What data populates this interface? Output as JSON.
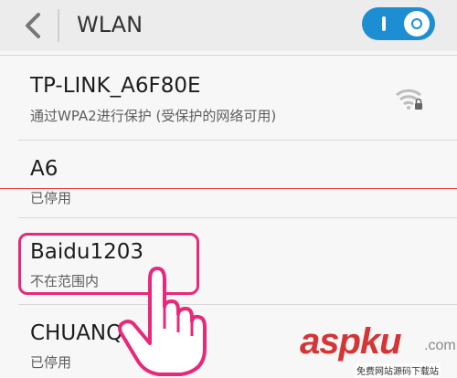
{
  "header": {
    "title": "WLAN",
    "back_icon": "chevron-left-icon",
    "toggle": {
      "state": "on",
      "accent": "#1e8ed3"
    }
  },
  "networks": [
    {
      "name": "TP-LINK_A6F80E",
      "status": "通过WPA2进行保护 (受保护的网络可用)",
      "signal_icon": "wifi-lock-icon"
    },
    {
      "name": "A6",
      "status": "已停用"
    },
    {
      "name": "Baidu1203",
      "status": "不在范围内"
    },
    {
      "name": "CHUANQI",
      "status": "已停用"
    }
  ],
  "annotation": {
    "highlight_color": "#e8297a",
    "pointer_icon": "hand-pointer-icon"
  },
  "watermark": {
    "brand": "aspku",
    "dot": ".com",
    "tagline": "免费网站源码下载站"
  }
}
